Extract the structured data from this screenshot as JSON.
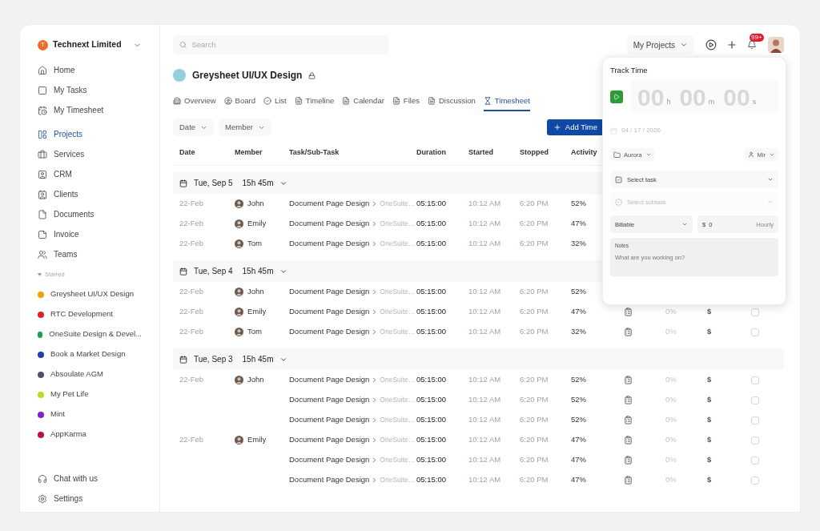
{
  "sidebar": {
    "workspace": {
      "initial": "T",
      "name": "Technext Limited"
    },
    "nav_top": [
      {
        "label": "Home",
        "selected": false
      },
      {
        "label": "My Tasks",
        "selected": false
      },
      {
        "label": "My Timesheet",
        "selected": false
      }
    ],
    "nav_main": [
      {
        "label": "Projects",
        "selected": true
      },
      {
        "label": "Services",
        "selected": false
      },
      {
        "label": "CRM",
        "selected": false
      },
      {
        "label": "Clients",
        "selected": false
      },
      {
        "label": "Documents",
        "selected": false
      },
      {
        "label": "Invoice",
        "selected": false
      },
      {
        "label": "Teams",
        "selected": false
      }
    ],
    "starred_label": "Starred",
    "starred_expanded": true,
    "starred": [
      {
        "name": "Greysheet UI/UX Design",
        "color": "#f59e0b"
      },
      {
        "name": "RTC Development",
        "color": "#dc2626"
      },
      {
        "name": "OneSuite Design & Devel...",
        "color": "#16a34a"
      },
      {
        "name": "Book a Market Design",
        "color": "#1e40af"
      },
      {
        "name": "Absoulate AGM",
        "color": "#4b5563"
      },
      {
        "name": "My Pet Life",
        "color": "#c5d62b"
      },
      {
        "name": "Mint",
        "color": "#7e22ce"
      },
      {
        "name": "AppKarma",
        "color": "#be123c"
      }
    ],
    "footer": [
      {
        "label": "Chat with us"
      },
      {
        "label": "Settings"
      }
    ]
  },
  "topbar": {
    "search": {
      "placeholder": "Search"
    },
    "projects_menu": "My Projects",
    "notification_count": "99+"
  },
  "project": {
    "title": "Greysheet UI/UX Design",
    "locked": true
  },
  "tabs": [
    {
      "label": "Overview",
      "selected": false
    },
    {
      "label": "Board",
      "selected": false
    },
    {
      "label": "List",
      "selected": false
    },
    {
      "label": "Timeline",
      "selected": false
    },
    {
      "label": "Calendar",
      "selected": false
    },
    {
      "label": "Files",
      "selected": false
    },
    {
      "label": "Discussion",
      "selected": false
    },
    {
      "label": "Timesheet",
      "selected": true
    }
  ],
  "filters": [
    "Date",
    "Member"
  ],
  "add_button": "Add Time",
  "table": {
    "columns": [
      "Date",
      "Member",
      "Task/Sub-Task",
      "Duration",
      "Started",
      "Stopped",
      "Activity"
    ],
    "groups": [
      {
        "date": "Tue, Sep 5",
        "total": "15h 45m",
        "expanded": true,
        "rows": [
          {
            "date": "22-Feb",
            "member": "John",
            "task": "Document Page Design",
            "subtask": "OneSuite…",
            "duration": "05:15:00",
            "started": "10:12 AM",
            "stopped": "6:20 PM",
            "activity": "52%"
          },
          {
            "date": "22-Feb",
            "member": "Emily",
            "task": "Document Page Design",
            "subtask": "OneSuite…",
            "duration": "05:15:00",
            "started": "10:12 AM",
            "stopped": "6:20 PM",
            "activity": "47%"
          },
          {
            "date": "22-Feb",
            "member": "Tom",
            "task": "Document Page Design",
            "subtask": "OneSuite…",
            "duration": "05:15:00",
            "started": "10:12 AM",
            "stopped": "6:20 PM",
            "activity": "32%"
          }
        ]
      },
      {
        "date": "Tue, Sep 4",
        "total": "15h 45m",
        "expanded": true,
        "rows": [
          {
            "date": "22-Feb",
            "member": "John",
            "task": "Document Page Design",
            "subtask": "OneSuite…",
            "duration": "05:15:00",
            "started": "10:12 AM",
            "stopped": "6:20 PM",
            "activity": "52%"
          },
          {
            "date": "22-Feb",
            "member": "Emily",
            "task": "Document Page Design",
            "subtask": "OneSuite…",
            "duration": "05:15:00",
            "started": "10:12 AM",
            "stopped": "6:20 PM",
            "activity": "47%",
            "cost": "0%",
            "billing": "$",
            "checked": false
          },
          {
            "date": "22-Feb",
            "member": "Tom",
            "task": "Document Page Design",
            "subtask": "OneSuite…",
            "duration": "05:15:00",
            "started": "10:12 AM",
            "stopped": "6:20 PM",
            "activity": "32%",
            "cost": "0%",
            "billing": "$",
            "checked": false
          }
        ]
      },
      {
        "date": "Tue, Sep 3",
        "total": "15h 45m",
        "expanded": true,
        "rows": [
          {
            "date": "22-Feb",
            "member": "John",
            "task": "Document Page Design",
            "subtask": "OneSuite…",
            "duration": "05:15:00",
            "started": "10:12 AM",
            "stopped": "6:20 PM",
            "activity": "52%",
            "cost": "0%",
            "billing": "$",
            "checked": false
          },
          {
            "task": "Document Page Design",
            "subtask": "OneSuite…",
            "duration": "05:15:00",
            "started": "10:12 AM",
            "stopped": "6:20 PM",
            "activity": "52%",
            "cost": "0%",
            "billing": "$",
            "checked": false
          },
          {
            "task": "Document Page Design",
            "subtask": "OneSuite…",
            "duration": "05:15:00",
            "started": "10:12 AM",
            "stopped": "6:20 PM",
            "activity": "52%",
            "cost": "0%",
            "billing": "$",
            "checked": false
          },
          {
            "date": "22-Feb",
            "member": "Emily",
            "task": "Document Page Design",
            "subtask": "OneSuite…",
            "duration": "05:15:00",
            "started": "10:12 AM",
            "stopped": "6:20 PM",
            "activity": "47%",
            "cost": "0%",
            "billing": "$",
            "checked": false
          },
          {
            "task": "Document Page Design",
            "subtask": "OneSuite…",
            "duration": "05:15:00",
            "started": "10:12 AM",
            "stopped": "6:20 PM",
            "activity": "47%",
            "cost": "0%",
            "billing": "$",
            "checked": false
          },
          {
            "task": "Document Page Design",
            "subtask": "OneSuite…",
            "duration": "05:15:00",
            "started": "10:12 AM",
            "stopped": "6:20 PM",
            "activity": "47%",
            "cost": "0%",
            "billing": "$",
            "checked": false
          }
        ]
      }
    ]
  },
  "track_time": {
    "title": "Track Time",
    "hours": "00",
    "h": "h",
    "minutes": "00",
    "m": "m",
    "seconds": "00",
    "s": "s",
    "date": "04 / 17 / 2026",
    "project": "Aurora",
    "member": "Mir",
    "task_placeholder": "Select task",
    "subtask_placeholder": "Select subtask",
    "billing": "Billable",
    "currency": "$",
    "rate": "0",
    "unit": "Hourly",
    "notes_label": "Notes",
    "notes_placeholder": "What are you working on?"
  }
}
